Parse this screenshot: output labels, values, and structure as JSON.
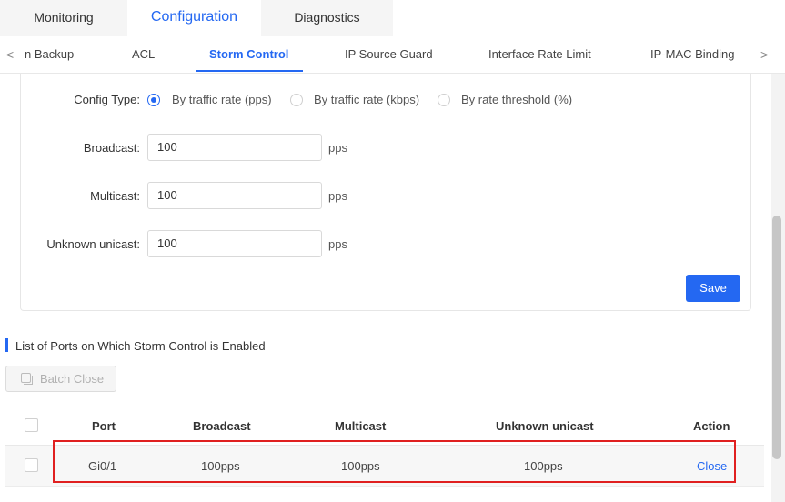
{
  "top_tabs": {
    "monitoring": "Monitoring",
    "configuration": "Configuration",
    "diagnostics": "Diagnostics"
  },
  "sub_tabs": {
    "backup": "n Backup",
    "acl": "ACL",
    "storm_control": "Storm Control",
    "ip_source_guard": "IP Source Guard",
    "interface_rate_limit": "Interface Rate Limit",
    "ip_mac_binding": "IP-MAC Binding",
    "left_arrow": "<",
    "right_arrow": ">"
  },
  "form": {
    "config_type_label": "Config Type:",
    "options": [
      "By traffic rate (pps)",
      "By traffic rate (kbps)",
      "By rate threshold (%)"
    ],
    "selected_option": "By traffic rate (pps)",
    "broadcast_label": "Broadcast:",
    "broadcast_value": "100",
    "multicast_label": "Multicast:",
    "multicast_value": "100",
    "unknown_unicast_label": "Unknown unicast:",
    "unknown_unicast_value": "100",
    "unit": "pps",
    "save_label": "Save"
  },
  "list": {
    "title": "List of Ports on Which Storm Control is Enabled",
    "batch_close_label": "Batch Close",
    "columns": [
      "Port",
      "Broadcast",
      "Multicast",
      "Unknown unicast",
      "Action"
    ],
    "rows": [
      {
        "port": "Gi0/1",
        "broadcast": "100pps",
        "multicast": "100pps",
        "unknown_unicast": "100pps",
        "action": "Close"
      }
    ]
  },
  "colors": {
    "accent": "#2468f2",
    "highlight": "#e02020"
  }
}
